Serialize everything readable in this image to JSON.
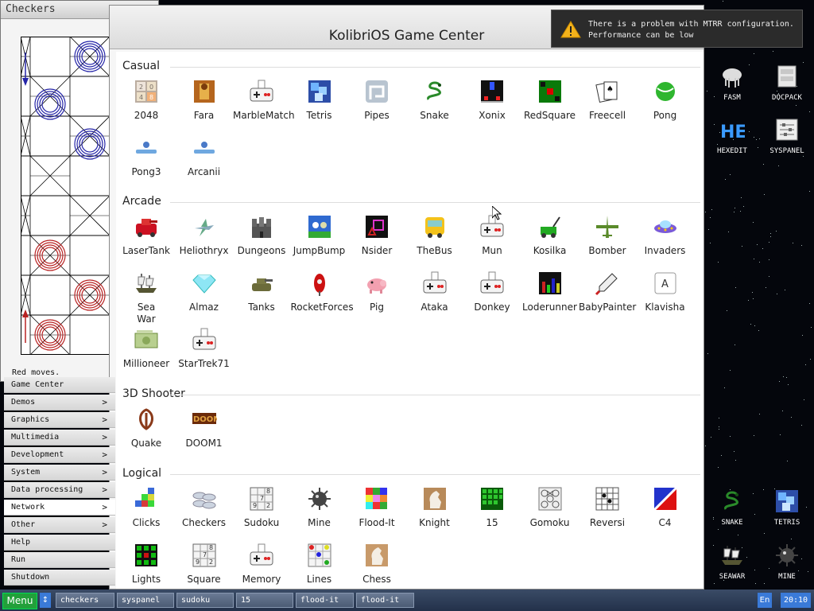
{
  "checkers": {
    "title": "Checkers",
    "status": "Red moves."
  },
  "menu": {
    "items": [
      {
        "label": "Game Center",
        "arrow": ""
      },
      {
        "label": "Demos",
        "arrow": ">"
      },
      {
        "label": "Graphics",
        "arrow": ">"
      },
      {
        "label": "Multimedia",
        "arrow": ">"
      },
      {
        "label": "Development",
        "arrow": ">"
      },
      {
        "label": "System",
        "arrow": ">"
      },
      {
        "label": "Data processing",
        "arrow": ">"
      },
      {
        "label": "Network",
        "arrow": ">"
      },
      {
        "label": "Other",
        "arrow": ">"
      },
      {
        "label": "Help",
        "arrow": ""
      },
      {
        "label": "Run",
        "arrow": ""
      },
      {
        "label": "Shutdown",
        "arrow": ""
      }
    ],
    "highlighted": "Network"
  },
  "gamecenter": {
    "title": "KolibriOS Game Center",
    "sections": [
      {
        "title": "Casual",
        "games": [
          {
            "name": "2048",
            "icon": "grid-2048-icon"
          },
          {
            "name": "Fara",
            "icon": "pharaoh-icon"
          },
          {
            "name": "MarbleMatch",
            "icon": "gamepad-icon"
          },
          {
            "name": "Tetris",
            "icon": "tetris-icon"
          },
          {
            "name": "Pipes",
            "icon": "pipes-icon"
          },
          {
            "name": "Snake",
            "icon": "snake-icon"
          },
          {
            "name": "Xonix",
            "icon": "xonix-icon"
          },
          {
            "name": "RedSquare",
            "icon": "redsquare-icon"
          },
          {
            "name": "Freecell",
            "icon": "cards-icon"
          },
          {
            "name": "Pong",
            "icon": "ball-icon"
          },
          {
            "name": "Pong3",
            "icon": "paddle-icon"
          },
          {
            "name": "Arcanii",
            "icon": "paddle-icon"
          }
        ]
      },
      {
        "title": "Arcade",
        "games": [
          {
            "name": "LaserTank",
            "icon": "tank-icon"
          },
          {
            "name": "Heliothryx",
            "icon": "plane-icon"
          },
          {
            "name": "Dungeons",
            "icon": "castle-icon"
          },
          {
            "name": "JumpBump",
            "icon": "bunny-icon"
          },
          {
            "name": "Nsider",
            "icon": "nsider-icon"
          },
          {
            "name": "TheBus",
            "icon": "bus-icon"
          },
          {
            "name": "Mun",
            "icon": "gamepad-icon"
          },
          {
            "name": "Kosilka",
            "icon": "lawnmower-icon"
          },
          {
            "name": "Bomber",
            "icon": "bomber-icon"
          },
          {
            "name": "Invaders",
            "icon": "ufo-icon"
          },
          {
            "name": "Sea\nWar",
            "icon": "ship-icon"
          },
          {
            "name": "Almaz",
            "icon": "diamond-icon"
          },
          {
            "name": "Tanks",
            "icon": "tank2-icon"
          },
          {
            "name": "RocketForces",
            "icon": "rocket-icon"
          },
          {
            "name": "Pig",
            "icon": "pig-icon"
          },
          {
            "name": "Ataka",
            "icon": "gamepad-icon"
          },
          {
            "name": "Donkey",
            "icon": "gamepad-icon"
          },
          {
            "name": "Loderunner",
            "icon": "loderunner-icon"
          },
          {
            "name": "BabyPainter",
            "icon": "pipette-icon"
          },
          {
            "name": "Klavisha",
            "icon": "key-icon"
          },
          {
            "name": "Millioneer",
            "icon": "money-icon"
          },
          {
            "name": "StarTrek71",
            "icon": "gamepad-icon"
          }
        ]
      },
      {
        "title": "3D Shooter",
        "games": [
          {
            "name": "Quake",
            "icon": "quake-icon"
          },
          {
            "name": "DOOM1",
            "icon": "doom-icon"
          }
        ]
      },
      {
        "title": "Logical",
        "games": [
          {
            "name": "Clicks",
            "icon": "blocks-icon"
          },
          {
            "name": "Checkers",
            "icon": "checkers-icon"
          },
          {
            "name": "Sudoku",
            "icon": "sudoku-icon"
          },
          {
            "name": "Mine",
            "icon": "mine-icon"
          },
          {
            "name": "Flood-It",
            "icon": "flood-icon"
          },
          {
            "name": "Knight",
            "icon": "knight-icon"
          },
          {
            "name": "15",
            "icon": "fifteen-icon"
          },
          {
            "name": "Gomoku",
            "icon": "gomoku-icon"
          },
          {
            "name": "Reversi",
            "icon": "reversi-icon"
          },
          {
            "name": "C4",
            "icon": "c4-icon"
          },
          {
            "name": "Lights",
            "icon": "lights-icon"
          },
          {
            "name": "Square",
            "icon": "sudoku-icon"
          },
          {
            "name": "Memory",
            "icon": "gamepad-icon"
          },
          {
            "name": "Lines",
            "icon": "lines-icon"
          },
          {
            "name": "Chess",
            "icon": "chess-icon"
          }
        ]
      }
    ]
  },
  "notification": {
    "text": "There is a problem with MTRR configuration.\nPerformance can be low",
    "icon": "warning-icon"
  },
  "desktop": {
    "icons": [
      {
        "label": "FASM",
        "icon": "fasm-icon"
      },
      {
        "label": "DOCPACK",
        "icon": "docpack-icon"
      },
      {
        "label": "HEXEDIT",
        "icon": "hexedit-icon"
      },
      {
        "label": "SYSPANEL",
        "icon": "syspanel-icon"
      },
      {
        "label": "SNAKE",
        "icon": "snake-icon"
      },
      {
        "label": "TETRIS",
        "icon": "tetris-icon"
      },
      {
        "label": "SEAWAR",
        "icon": "ship-icon"
      },
      {
        "label": "MINE",
        "icon": "mine-icon"
      }
    ]
  },
  "taskbar": {
    "menu_label": "Menu",
    "swap_label": "↕",
    "tasks": [
      "checkers",
      "syspanel",
      "sudoku",
      "15",
      "flood-it",
      "flood-it"
    ],
    "lang": "En",
    "clock": "20:10"
  },
  "colors": {
    "accent": "#22a03a",
    "taskbar": "#2c3a55",
    "clock_bg": "#3a7ad8"
  }
}
